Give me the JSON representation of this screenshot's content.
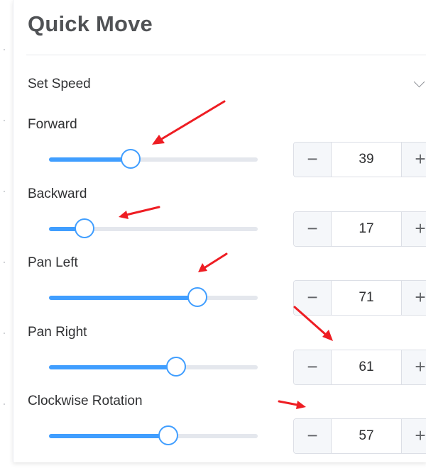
{
  "panel": {
    "title": "Quick Move"
  },
  "speed": {
    "label": "Set Speed",
    "toggle_icon": "chevron-down-icon"
  },
  "sliders": [
    {
      "label": "Forward",
      "value": 39
    },
    {
      "label": "Backward",
      "value": 17
    },
    {
      "label": "Pan Left",
      "value": 71
    },
    {
      "label": "Pan Right",
      "value": 61
    },
    {
      "label": "Clockwise Rotation",
      "value": 57
    }
  ],
  "stepper": {
    "minus_symbol": "−",
    "plus_symbol": "+"
  },
  "colors": {
    "accent": "#409eff",
    "annotation": "#ee1d23",
    "track": "#e4e7ed"
  }
}
